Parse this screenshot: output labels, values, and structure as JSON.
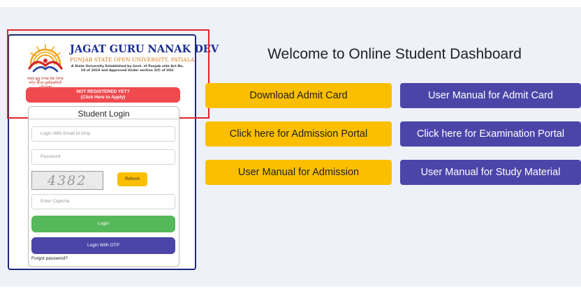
{
  "university": {
    "title": "JAGAT GURU NANAK DEV",
    "subtitle": "PUNJAB STATE OPEN UNIVERSITY, PATIALA",
    "note": "A State University Established by Govt. of Punjab vide Act No. 19 of 2019 and Approved Under section 2(f) of UGC",
    "punjabi_name": "ਜਗਤ ਗੁਰੂ ਨਾਨਕ ਦੇਵ ਪੰਜਾਬ ਸਟੇਟ ਓਪਨ ਯੂਨੀਵਰਸਿਟੀ ਪਟਿਆਲਾ"
  },
  "register": {
    "line1": "NOT REGISTERED YET?",
    "line2": "(Click Here to Apply)"
  },
  "login": {
    "title": "Student Login",
    "email_placeholder": "Login With Email Id Only",
    "password_placeholder": "Password",
    "captcha_text": "4382",
    "refresh_label": "Refresh",
    "captcha_placeholder": "Enter Captcha",
    "login_label": "Login",
    "otp_label": "Login With OTP",
    "forgot_label": "Forgot password?"
  },
  "dashboard": {
    "welcome": "Welcome to Online Student Dashboard",
    "buttons": [
      {
        "label": "Download Admit Card"
      },
      {
        "label": "User Manual for Admit Card"
      },
      {
        "label": "Click here for Admission Portal"
      },
      {
        "label": "Click here for Examination Portal"
      },
      {
        "label": "User Manual for Admission"
      },
      {
        "label": "User Manual for Study Material"
      }
    ]
  },
  "colors": {
    "yellow": "#fbbf00",
    "purple": "#4b45a8",
    "green": "#55b85a",
    "red": "#f04a4f",
    "highlight": "#e0252a"
  },
  "icons": {
    "logo": "university-emblem-icon"
  }
}
